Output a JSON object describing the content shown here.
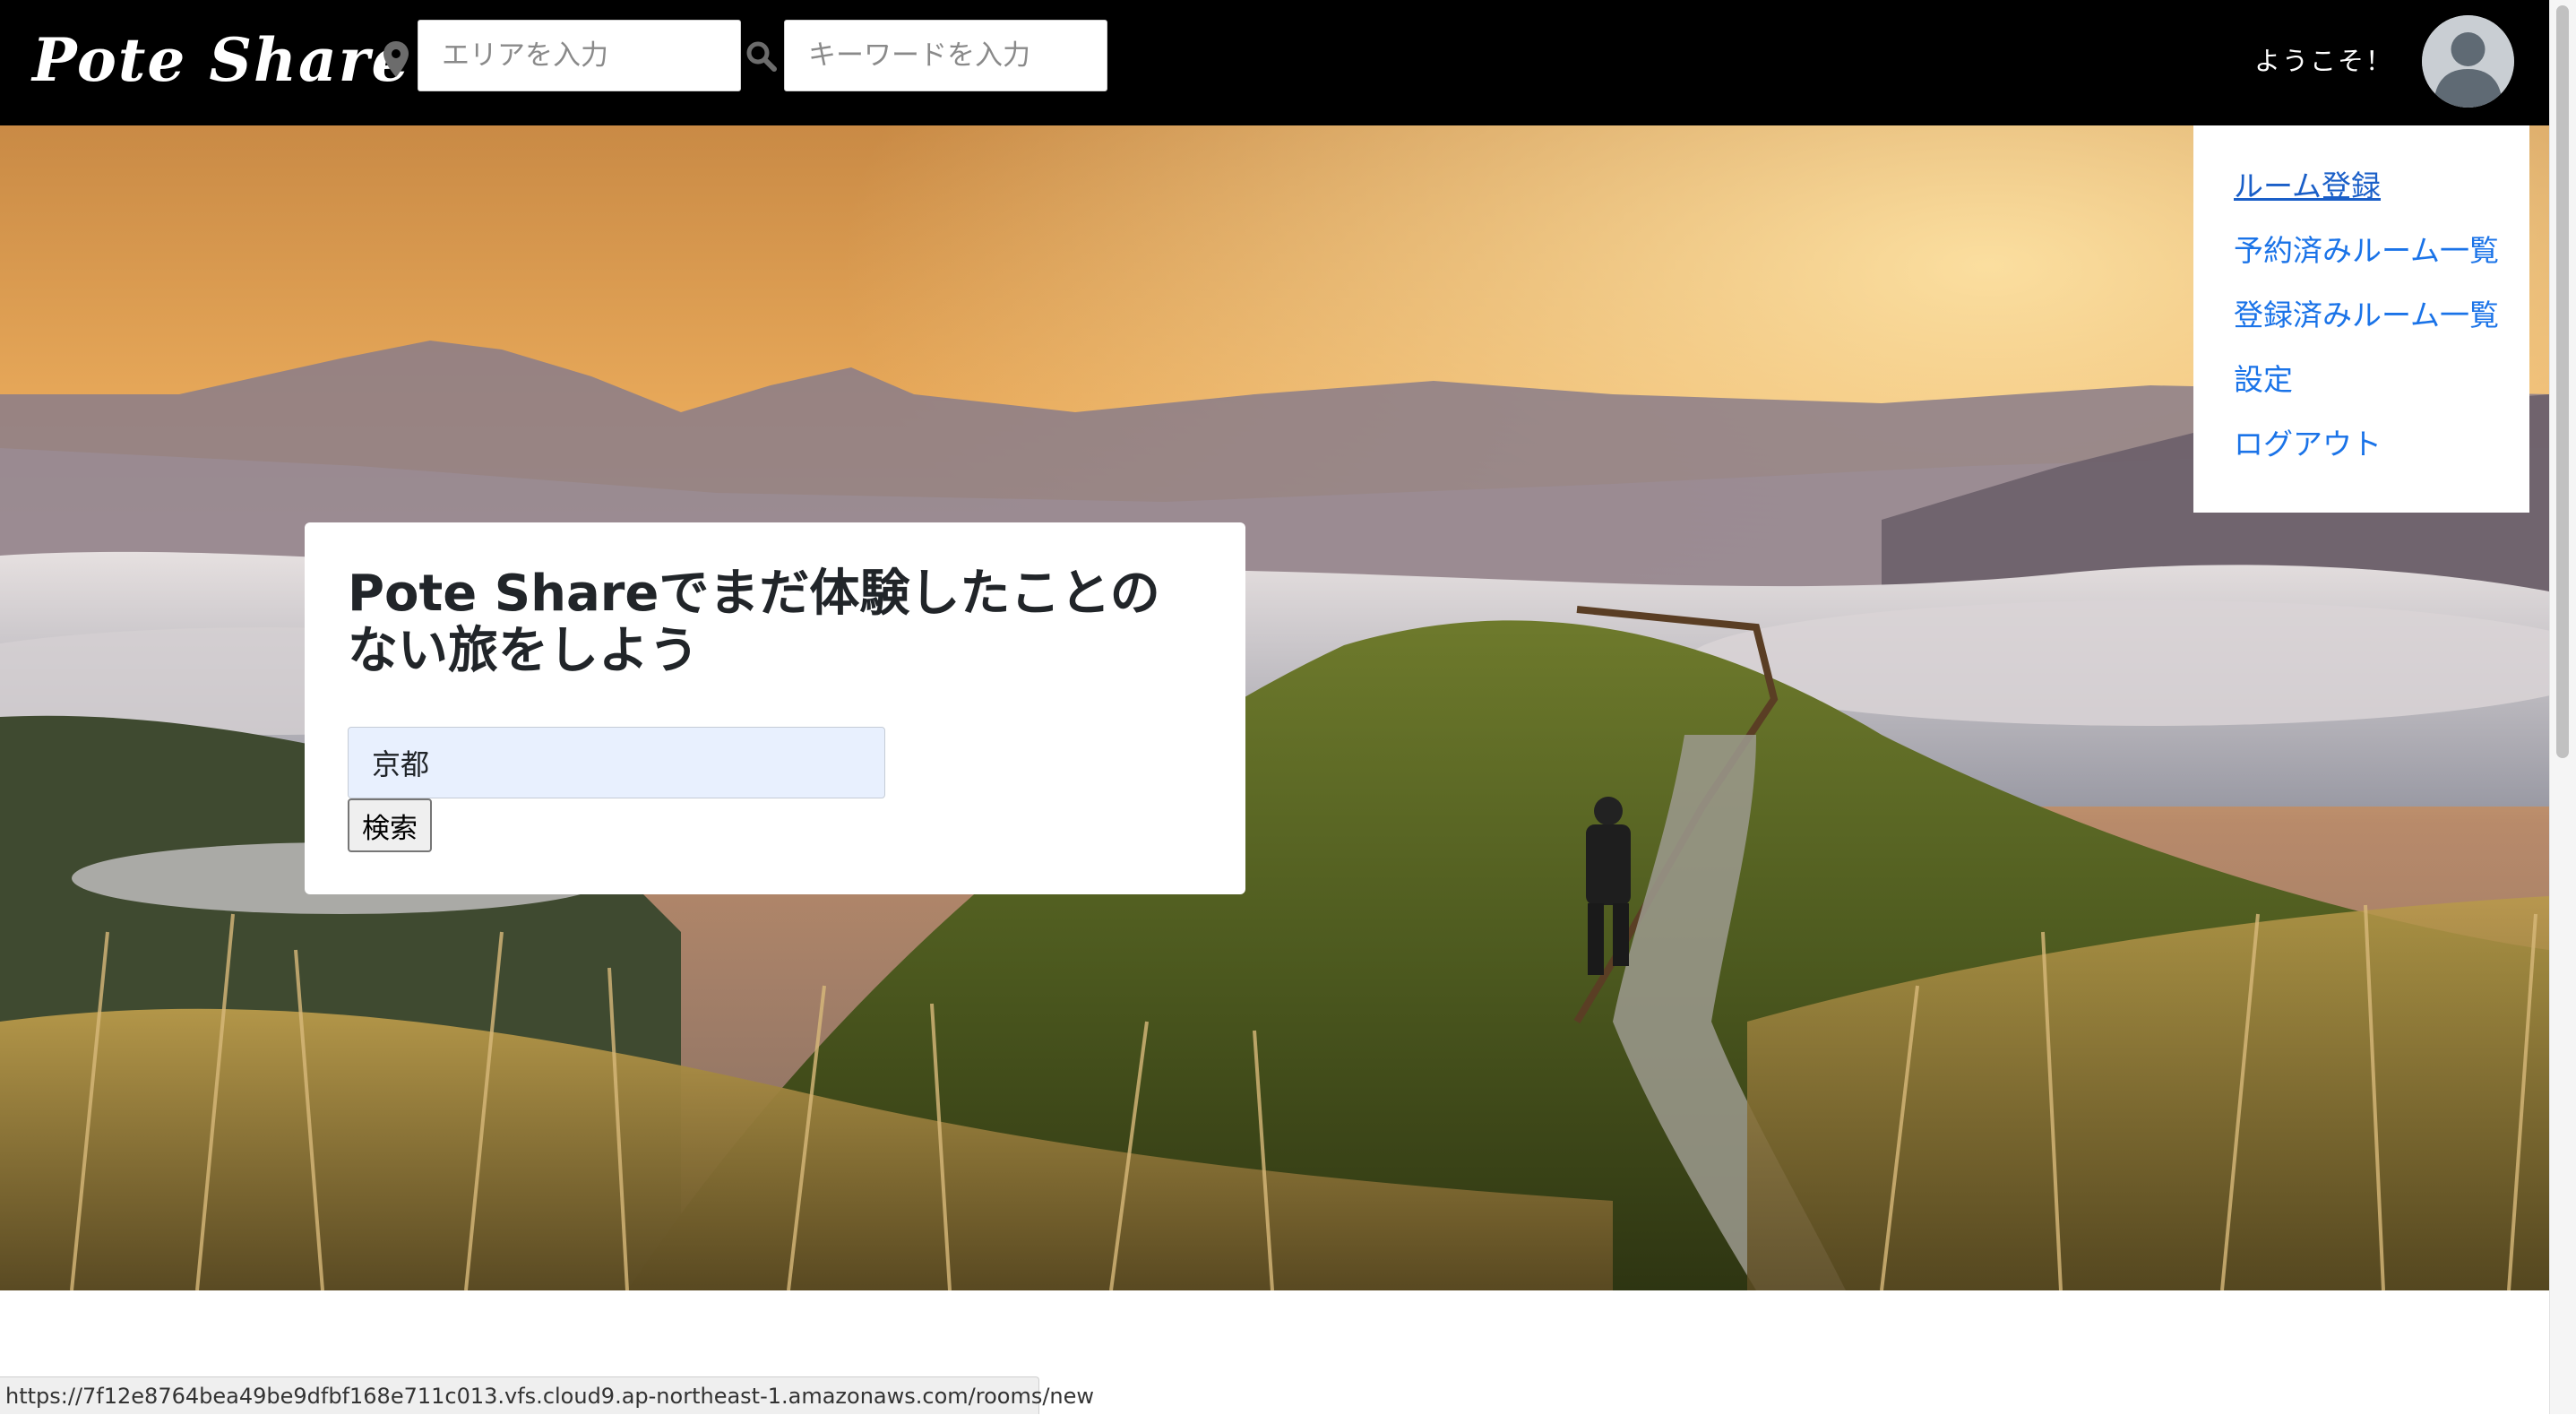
{
  "header": {
    "logo": "Pote Share",
    "area_placeholder": "エリアを入力",
    "keyword_placeholder": "キーワードを入力",
    "welcome": "ようこそ！"
  },
  "search_card": {
    "title": "Pote Shareでまだ体験したことのない旅をしよう",
    "input_value": "京都",
    "button_label": "検索"
  },
  "user_menu": {
    "items": [
      {
        "label": "ルーム登録"
      },
      {
        "label": "予約済みルーム一覧"
      },
      {
        "label": "登録済みルーム一覧"
      },
      {
        "label": "設定"
      },
      {
        "label": "ログアウト"
      }
    ]
  },
  "status_bar": {
    "url": "https://7f12e8764bea49be9dfbf168e711c013.vfs.cloud9.ap-northeast-1.amazonaws.com/rooms/new"
  },
  "colors": {
    "header_bg": "#000000",
    "link": "#1a73e8",
    "autofill_bg": "#e8f0fe"
  },
  "icons": [
    "map-pin-icon",
    "search-icon",
    "user-avatar-icon"
  ]
}
